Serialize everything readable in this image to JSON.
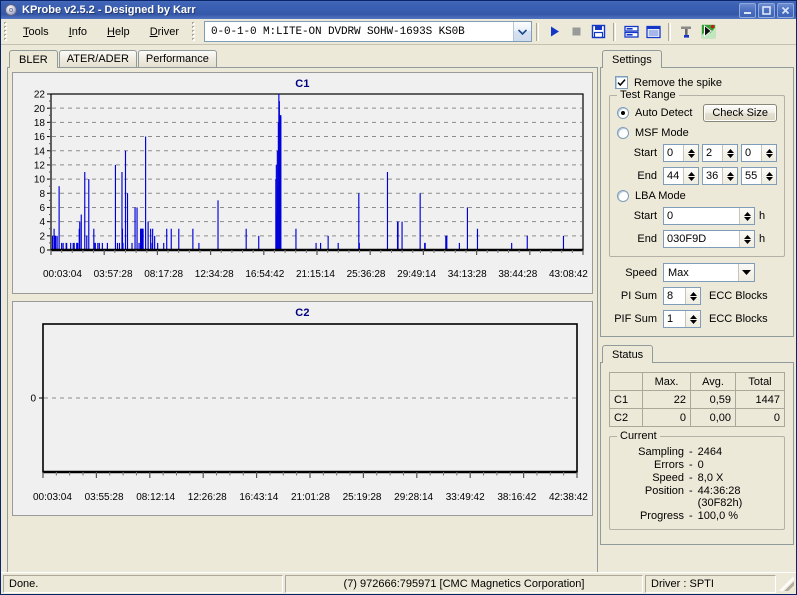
{
  "window": {
    "title": "KProbe v2.5.2 - Designed by Karr",
    "icon": "disc-icon",
    "minimize_label": "–",
    "maximize_label": "□",
    "close_label": "✕"
  },
  "menu": {
    "items": [
      {
        "label": "Tools",
        "accel": "T"
      },
      {
        "label": "Info",
        "accel": "I"
      },
      {
        "label": "Help",
        "accel": "H"
      },
      {
        "label": "Driver",
        "accel": "D"
      }
    ]
  },
  "toolbar": {
    "drive_value": "0-0-1-0 M:LITE-ON DVDRW SOHW-1693S KS0B",
    "buttons": [
      {
        "name": "start-button",
        "icon": "play-icon"
      },
      {
        "name": "stop-button",
        "icon": "stop-icon"
      },
      {
        "name": "save-button",
        "icon": "floppy-disk-icon"
      },
      {
        "name": "view-graph-button",
        "icon": "graph-view-icon"
      },
      {
        "name": "view-table-button",
        "icon": "table-view-icon"
      },
      {
        "name": "tools-button",
        "icon": "hammer-icon"
      },
      {
        "name": "about-button",
        "icon": "flag-icon"
      }
    ]
  },
  "left": {
    "tabs": [
      {
        "label": "BLER",
        "active": true
      },
      {
        "label": "ATER/ADER",
        "active": false
      },
      {
        "label": "Performance",
        "active": false
      }
    ]
  },
  "settings": {
    "tab_label": "Settings",
    "remove_spike_label": "Remove the spike",
    "remove_spike_checked": true,
    "test_range_legend": "Test Range",
    "auto_detect_label": "Auto Detect",
    "auto_detect_selected": true,
    "check_size_label": "Check Size",
    "msf_mode_label": "MSF Mode",
    "msf_mode_selected": false,
    "msf_start_label": "Start",
    "msf_start": [
      "0",
      "2",
      "0"
    ],
    "msf_end_label": "End",
    "msf_end": [
      "44",
      "36",
      "55"
    ],
    "lba_mode_label": "LBA Mode",
    "lba_mode_selected": false,
    "lba_start_label": "Start",
    "lba_start_value": "0",
    "lba_start_unit": "h",
    "lba_end_label": "End",
    "lba_end_value": "030F9D",
    "lba_end_unit": "h",
    "speed_label": "Speed",
    "speed_value": "Max",
    "pi_sum_label": "PI Sum",
    "pi_sum_value": "8",
    "pi_sum_unit": "ECC Blocks",
    "pif_sum_label": "PIF Sum",
    "pif_sum_value": "1",
    "pif_sum_unit": "ECC Blocks"
  },
  "status_panel": {
    "tab_label": "Status",
    "table": {
      "headers": [
        "",
        "Max.",
        "Avg.",
        "Total"
      ],
      "rows": [
        {
          "name": "C1",
          "max": "22",
          "avg": "0,59",
          "total": "1447"
        },
        {
          "name": "C2",
          "max": "0",
          "avg": "0,00",
          "total": "0"
        }
      ]
    },
    "current_legend": "Current",
    "current": [
      {
        "label": "Sampling",
        "value": "2464"
      },
      {
        "label": "Errors",
        "value": "0"
      },
      {
        "label": "Speed",
        "value": "8,0  X"
      },
      {
        "label": "Position",
        "value": "44:36:28 (30F82h)"
      },
      {
        "label": "Progress",
        "value": "100,0 %"
      }
    ]
  },
  "statusbar": {
    "left": "Done.",
    "center": "(7) 972666:795971 [CMC Magnetics Corporation]",
    "right": "Driver : SPTI"
  },
  "colors": {
    "bar": "#0000d8",
    "title_text": "#000080",
    "plot_bg": "#f0f0f0",
    "face": "#ece9d8",
    "accent": "#3a5fb2"
  },
  "chart_data": [
    {
      "type": "bar",
      "title": "C1",
      "xlabel": "",
      "ylabel": "",
      "ylim": [
        0,
        22
      ],
      "yticks": [
        0,
        2,
        4,
        6,
        8,
        10,
        12,
        14,
        16,
        18,
        20,
        22
      ],
      "grid": true,
      "legend": "none",
      "xtick_labels": [
        "00:03:04",
        "03:57:28",
        "08:17:28",
        "12:34:28",
        "16:54:42",
        "21:15:14",
        "25:36:28",
        "29:49:14",
        "34:13:28",
        "38:44:28",
        "43:08:42"
      ],
      "x_unit": "time (mm:ss:ff)",
      "summary": {
        "max": 22,
        "avg": 0.59,
        "total": 1447,
        "samples": 2464
      },
      "values": [
        0,
        0,
        2,
        0,
        0,
        3,
        0,
        2,
        2,
        0,
        0,
        2,
        0,
        0,
        0,
        9,
        0,
        0,
        0,
        0,
        1,
        0,
        0,
        1,
        0,
        0,
        0,
        0,
        0,
        1,
        1,
        0,
        0,
        0,
        0,
        0,
        0,
        0,
        1,
        0,
        0,
        0,
        0,
        1,
        0,
        1,
        0,
        0,
        0,
        0,
        1,
        1,
        1,
        0,
        0,
        3,
        4,
        0,
        0,
        5,
        0,
        0,
        0,
        0,
        0,
        0,
        11,
        0,
        0,
        0,
        2,
        0,
        0,
        0,
        10,
        0,
        0,
        0,
        0,
        0,
        0,
        0,
        0,
        0,
        3,
        0,
        1,
        1,
        0,
        0,
        0,
        0,
        1,
        0,
        0,
        1,
        0,
        0,
        0,
        0,
        0,
        1,
        0,
        0,
        0,
        0,
        0,
        0,
        0,
        0,
        0,
        1,
        0,
        0,
        0,
        0,
        0,
        0,
        0,
        0,
        0,
        0,
        0,
        0,
        0,
        0,
        0,
        12,
        0,
        0,
        0,
        1,
        0,
        0,
        0,
        1,
        0,
        0,
        0,
        0,
        11,
        3,
        1,
        0,
        0,
        0,
        0,
        14,
        0,
        0,
        0,
        8,
        0,
        0,
        0,
        0,
        0,
        0,
        0,
        0,
        1,
        0,
        0,
        0,
        0,
        0,
        6,
        0,
        0,
        0,
        6,
        0,
        0,
        0,
        1,
        0,
        0,
        3,
        3,
        3,
        3,
        3,
        3,
        0,
        0,
        0,
        0,
        16,
        0,
        0,
        0,
        0,
        4,
        0,
        0,
        0,
        0,
        3,
        0,
        0,
        1,
        3,
        0,
        0,
        0,
        2,
        0,
        0,
        0,
        0,
        0,
        1,
        0,
        0,
        0,
        0,
        0,
        0,
        0,
        0,
        0,
        0,
        0,
        1,
        0,
        0,
        0,
        0,
        0,
        3,
        0,
        0,
        0,
        0,
        0,
        0,
        0,
        0,
        3,
        0,
        0,
        0,
        0,
        0,
        0,
        0,
        0,
        0,
        0,
        0,
        0,
        0,
        0,
        3,
        0,
        0,
        0,
        0,
        0,
        0,
        0,
        0,
        0,
        0,
        0,
        0,
        0,
        0,
        0,
        0,
        0,
        0,
        0,
        0,
        0,
        0,
        0,
        0,
        0,
        0,
        0,
        3,
        0,
        0,
        0,
        0,
        0,
        0,
        0,
        0,
        0,
        0,
        0,
        1,
        0,
        0,
        0,
        0,
        0,
        0,
        0,
        0,
        0,
        0,
        0,
        0,
        0,
        0,
        0,
        0,
        0,
        0,
        0,
        0,
        0,
        0,
        0,
        0,
        0,
        0,
        0,
        0,
        0,
        0,
        0,
        0,
        0,
        0,
        0,
        0,
        0,
        7,
        0,
        0,
        0,
        0,
        0,
        0,
        0,
        0,
        0,
        0,
        0,
        0,
        0,
        0,
        0,
        0,
        0,
        0,
        0,
        0,
        0,
        0,
        0,
        0,
        0,
        0,
        0,
        0,
        0,
        0,
        0,
        0,
        0,
        0,
        0,
        0,
        0,
        0,
        0,
        0,
        0,
        0,
        0,
        0,
        0,
        0,
        0,
        0,
        0,
        0,
        0,
        0,
        0,
        0,
        0,
        3,
        0,
        0,
        0,
        0,
        0,
        0,
        0,
        0,
        0,
        0,
        0,
        0,
        0,
        0,
        0,
        0,
        0,
        0,
        0,
        0,
        0,
        0,
        0,
        0,
        2,
        0,
        0,
        0,
        0,
        0,
        0,
        0,
        0,
        0,
        0,
        0,
        0,
        0,
        0,
        0,
        0,
        0,
        0,
        0,
        0,
        0,
        0,
        0,
        0,
        0,
        0,
        0,
        0,
        0,
        0,
        0,
        0,
        0,
        10,
        12,
        5,
        14,
        9,
        18,
        22,
        21,
        19,
        19,
        19,
        0,
        0,
        0,
        0,
        0,
        0,
        0,
        0,
        0,
        0,
        0,
        0,
        0,
        0,
        0,
        0,
        0,
        0,
        0,
        0,
        0,
        0,
        0,
        0,
        0,
        0,
        0,
        0,
        0,
        3,
        0,
        0,
        0,
        0,
        0,
        0,
        0,
        0,
        0,
        0,
        0,
        0,
        0,
        0,
        0,
        0,
        0,
        0,
        0,
        0,
        0,
        0,
        0,
        0,
        0,
        0,
        0,
        0,
        0,
        0,
        0,
        0,
        0,
        0,
        0,
        0,
        0,
        0,
        0,
        1,
        0,
        0,
        0,
        0,
        0,
        0,
        0,
        0,
        1,
        0,
        0,
        0,
        0,
        0,
        0,
        0,
        0,
        0,
        0,
        0,
        0,
        0,
        0,
        2,
        0,
        0,
        0,
        0,
        0,
        0,
        0,
        0,
        0,
        0,
        0,
        0,
        0,
        0,
        0,
        0,
        0,
        0,
        0,
        1,
        0,
        0,
        0,
        0,
        0,
        0,
        0,
        0,
        0,
        0,
        0,
        0,
        0,
        0,
        0,
        0,
        0,
        0,
        0,
        0,
        0,
        0,
        0,
        0,
        0,
        0,
        0,
        0,
        0,
        0,
        0,
        0,
        0,
        0,
        0,
        0,
        0,
        0,
        0,
        0,
        8,
        1,
        0,
        0,
        0,
        0,
        0,
        0,
        0,
        0,
        0,
        0,
        0,
        0,
        0,
        0,
        0,
        0,
        0,
        0,
        0,
        0,
        0,
        0,
        0,
        0,
        0,
        0,
        0,
        0,
        0,
        0,
        0,
        0,
        0,
        0,
        0,
        0,
        0,
        0,
        0,
        0,
        0,
        0,
        0,
        0,
        0,
        0,
        0,
        0,
        0,
        0,
        0,
        0,
        0,
        0,
        0,
        11,
        0,
        0,
        0,
        0,
        0,
        0,
        0,
        0,
        0,
        0,
        0,
        0,
        0,
        0,
        0,
        0,
        0,
        0,
        0,
        4,
        4,
        0,
        0,
        0,
        0,
        0,
        0,
        0,
        4,
        0,
        0,
        0,
        0,
        0,
        0,
        0,
        0,
        0,
        0,
        0,
        0,
        0,
        0,
        0,
        0,
        0,
        0,
        0,
        0,
        0,
        0,
        0,
        0,
        0,
        0,
        0,
        0,
        0,
        0,
        0,
        0,
        0,
        0,
        0,
        8,
        0,
        0,
        0,
        0,
        0,
        0,
        0,
        0,
        1,
        1,
        0,
        0,
        0,
        0,
        0,
        0,
        0,
        0,
        0,
        0,
        0,
        0,
        0,
        0,
        0,
        0,
        0,
        0,
        0,
        0,
        0,
        0,
        0,
        0,
        0,
        0,
        0,
        0,
        0,
        0,
        0,
        0,
        0,
        0,
        0,
        0,
        0,
        0,
        0,
        0,
        2,
        2,
        2,
        0,
        0,
        0,
        0,
        0,
        0,
        0,
        0,
        0,
        0,
        0,
        0,
        0,
        0,
        0,
        0,
        0,
        0,
        0,
        0,
        0,
        0,
        0,
        0,
        1,
        0,
        0,
        0,
        0,
        0,
        0,
        0,
        0,
        0,
        0,
        0,
        0,
        0,
        0,
        0,
        6,
        0,
        0,
        0,
        0,
        0,
        0,
        0,
        0,
        0,
        0,
        0,
        0,
        0,
        0,
        0,
        0,
        0,
        0,
        0,
        3,
        0,
        0,
        0,
        0,
        0,
        0,
        0,
        0,
        0,
        0,
        0,
        0,
        0,
        0,
        0,
        0,
        0,
        0,
        0,
        0,
        0,
        0,
        0,
        0,
        0,
        0,
        0,
        0,
        0,
        0,
        0,
        0,
        0,
        0,
        0,
        0,
        0,
        0,
        0,
        0,
        0,
        0,
        0,
        0,
        0,
        0,
        0,
        0,
        0,
        0,
        0,
        0,
        0,
        0,
        0,
        0,
        0,
        0,
        0,
        0,
        0,
        0,
        0,
        0,
        0,
        0,
        0,
        1,
        0,
        0,
        0,
        0,
        0,
        0,
        0,
        0,
        0,
        0,
        0,
        0,
        0,
        0,
        0,
        0,
        0,
        0,
        0,
        0,
        0,
        0,
        0,
        0,
        0,
        0,
        0,
        0,
        0,
        0,
        2,
        0,
        0,
        0,
        0,
        0,
        0,
        0,
        0,
        0,
        0,
        0,
        0,
        0,
        0,
        0,
        0,
        0,
        0,
        0,
        0,
        0,
        0,
        0,
        0,
        0,
        0,
        0,
        0,
        0,
        0,
        0,
        0,
        0,
        0,
        0,
        0,
        0,
        0,
        0,
        0,
        0,
        0,
        0,
        0,
        0,
        0,
        0,
        0,
        0,
        0,
        0,
        0,
        0,
        0,
        0,
        0,
        0,
        0,
        0,
        0,
        0,
        0,
        0,
        0,
        0,
        0,
        0,
        0,
        0,
        0,
        0,
        2,
        0,
        0,
        0,
        0,
        0,
        0,
        0,
        0,
        0,
        0,
        0,
        0,
        0,
        0,
        0,
        0,
        0,
        0,
        0,
        0,
        0,
        0,
        0,
        0,
        0,
        0,
        0,
        0,
        0,
        0,
        0,
        0,
        0,
        0,
        0,
        0,
        0,
        0,
        0
      ]
    },
    {
      "type": "bar",
      "title": "C2",
      "xlabel": "",
      "ylabel": "",
      "ylim": [
        0,
        0
      ],
      "yticks": [
        0
      ],
      "grid": true,
      "legend": "none",
      "xtick_labels": [
        "00:03:04",
        "03:55:28",
        "08:12:14",
        "12:26:28",
        "16:43:14",
        "21:01:28",
        "25:19:28",
        "29:28:14",
        "33:49:42",
        "38:16:42",
        "42:38:42"
      ],
      "x_unit": "time (mm:ss:ff)",
      "summary": {
        "max": 0,
        "avg": 0.0,
        "total": 0
      },
      "values": []
    }
  ]
}
